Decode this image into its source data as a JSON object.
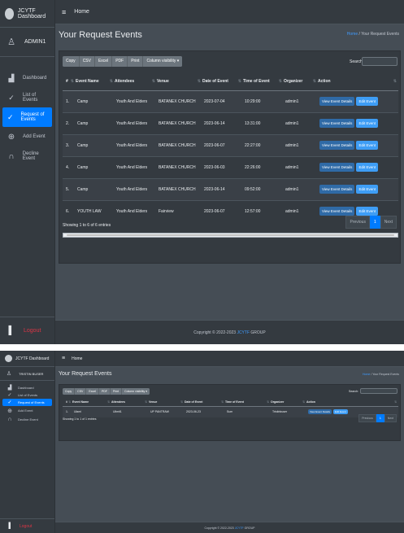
{
  "shot1": {
    "brand": "JCYTF Dashboard",
    "user": "ADMIN1",
    "topbar_menu": "≡",
    "topbar_home": "Home",
    "nav": [
      {
        "label": "Dashboard",
        "icon": "chart-icon"
      },
      {
        "label": "List of Events",
        "icon": "check-icon"
      },
      {
        "label": "Request of Events",
        "icon": "check-icon"
      },
      {
        "label": "Add Event",
        "icon": "plus-circle-icon"
      },
      {
        "label": "Decline Event",
        "icon": "headset-icon"
      }
    ],
    "logout": "Logout",
    "page_title": "Your Request Events",
    "crumb_home": "Home",
    "crumb_current": "/ Your Request Events",
    "buttons": [
      "Copy",
      "CSV",
      "Excel",
      "PDF",
      "Print",
      "Column visibility ▾"
    ],
    "search_label": "Search:",
    "columns": [
      "#",
      "Event Name",
      "Attendees",
      "Venue",
      "Date of Event",
      "Time of Event",
      "Organizer",
      "Action"
    ],
    "rows": [
      [
        "1.",
        "Camp",
        "Youth And Elders",
        "BATANEX CHURCH",
        "2023-07-04",
        "10:29:00",
        "admin1"
      ],
      [
        "2.",
        "Camp",
        "Youth And Elders",
        "BATANEX CHURCH",
        "2023-06-14",
        "13:31:00",
        "admin1"
      ],
      [
        "3.",
        "Camp",
        "Youth And Elders",
        "BATANEX CHURCH",
        "2023-06-07",
        "22:27:00",
        "admin1"
      ],
      [
        "4.",
        "Camp",
        "Youth And Elders",
        "BATANEX CHURCH",
        "2023-06-03",
        "22:26:00",
        "admin1"
      ],
      [
        "5.",
        "Camp",
        "Youth And Elders",
        "BATANEX CHURCH",
        "2023-06-14",
        "09:52:00",
        "admin1"
      ],
      [
        "6.",
        "YOUTH LAW",
        "Youth And Elders",
        "Fairview",
        "2023-06-07",
        "12:57:00",
        "admin1"
      ]
    ],
    "view_label": "View Event Details",
    "edit_label": "Edit Event",
    "info": "Showing 1 to 6 of 6 entries",
    "prev": "Previous",
    "page": "1",
    "next": "Next",
    "footer_text": "Copyright © 2022-2023",
    "footer_org": "JCYTF",
    "footer_suffix": "GROUP"
  },
  "shot2": {
    "brand": "JCYTF Dashboard",
    "user": "TRISTIN BUSER",
    "topbar_menu": "≡",
    "topbar_home": "Home",
    "nav": [
      {
        "label": "Dashboard",
        "icon": "chart-icon"
      },
      {
        "label": "List of Events",
        "icon": "check-icon"
      },
      {
        "label": "Request of Events",
        "icon": "check-icon"
      },
      {
        "label": "Add Event",
        "icon": "plus-circle-icon"
      },
      {
        "label": "Decline Event",
        "icon": "headset-icon"
      }
    ],
    "logout": "Logout",
    "page_title": "Your Request Events",
    "crumb_home": "Home",
    "crumb_current": "/ Your Request Events",
    "buttons": [
      "Copy",
      "CSV",
      "Excel",
      "PDF",
      "Print",
      "Column visibility ▾"
    ],
    "search_label": "Search:",
    "columns": [
      "#",
      "Event Name",
      "Attendees",
      "Venue",
      "Date of Event",
      "Time of Event",
      "Organizer",
      "Action"
    ],
    "rows": [
      [
        "1.",
        "Ulami",
        "Ulimit1",
        "UP PANTRAW",
        "2023-06-23",
        "Sum",
        "Tristinbuser"
      ]
    ],
    "view_label": "View Event Details",
    "edit_label": "Edit Event",
    "info": "Showing 1 to 1 of 1 entries",
    "prev": "Previous",
    "page": "1",
    "next": "Next",
    "footer_text": "Copyright © 2022-2023",
    "footer_org": "JCYTF",
    "footer_suffix": "GROUP"
  },
  "colors": {
    "sidebar": "#343a40",
    "content": "#454d55",
    "accent": "#007bff",
    "logout": "#dc3545"
  }
}
